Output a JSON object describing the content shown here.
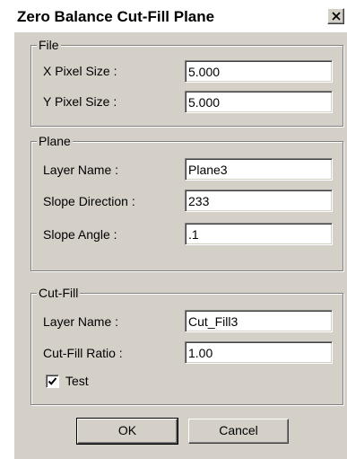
{
  "window": {
    "title": "Zero Balance Cut-Fill Plane",
    "close_icon": "close-icon"
  },
  "file_group": {
    "title": "File",
    "x_pixel_size_label": "X Pixel Size :",
    "x_pixel_size_value": "5.000",
    "y_pixel_size_label": "Y Pixel Size :",
    "y_pixel_size_value": "5.000"
  },
  "plane_group": {
    "title": "Plane",
    "layer_name_label": "Layer Name :",
    "layer_name_value": "Plane3",
    "slope_direction_label": "Slope Direction :",
    "slope_direction_value": "233",
    "slope_angle_label": "Slope Angle :",
    "slope_angle_value": ".1"
  },
  "cutfill_group": {
    "title": "Cut-Fill",
    "layer_name_label": "Layer Name :",
    "layer_name_value": "Cut_Fill3",
    "ratio_label": "Cut-Fill Ratio :",
    "ratio_value": "1.00",
    "test_label": "Test",
    "test_checked": true
  },
  "buttons": {
    "ok_label": "OK",
    "cancel_label": "Cancel"
  }
}
